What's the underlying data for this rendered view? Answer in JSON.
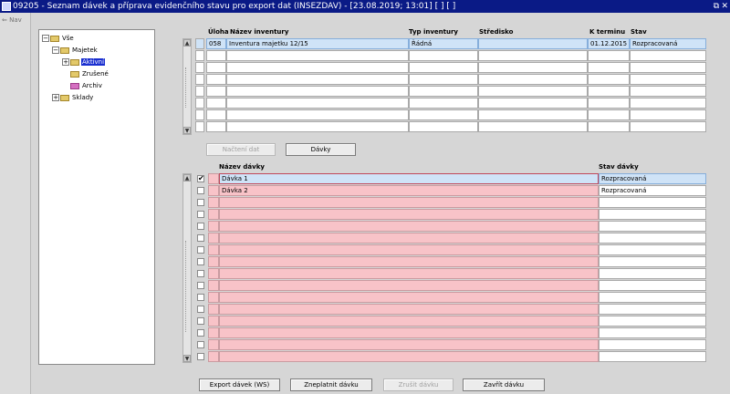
{
  "window": {
    "title": "09205 - Seznam dávek a příprava evidenčního stavu pro export dat (INSEZDAV) - [23.08.2019; 13:01]  [ ]  [ ]",
    "restore_glyph": "⧉",
    "close_glyph": "✕"
  },
  "nav": {
    "label": "Nav",
    "icon": "nav-arrow-icon"
  },
  "tree": {
    "nodes": [
      {
        "label": "Vše",
        "toggle": "−"
      },
      {
        "label": "Majetek",
        "toggle": "−"
      },
      {
        "label": "Aktivní",
        "toggle": "+",
        "selected": true
      },
      {
        "label": "Zrušené"
      },
      {
        "label": "Archiv"
      },
      {
        "label": "Sklady",
        "toggle": "+"
      }
    ]
  },
  "inventory": {
    "headers": {
      "uloha": "Úloha",
      "nazev": "Název inventury",
      "typ": "Typ inventury",
      "stredisko": "Středisko",
      "termin": "K terminu",
      "stav": "Stav"
    },
    "rows": [
      {
        "uloha": "058",
        "nazev": "Inventura majetku 12/15",
        "typ": "Řádná",
        "stredisko": "",
        "termin": "01.12.2015",
        "stav": "Rozpracovaná"
      }
    ]
  },
  "mid_buttons": {
    "nacteni": "Načtení dat",
    "davky": "Dávky"
  },
  "batches": {
    "headers": {
      "nazev": "Název dávky",
      "stav": "Stav dávky"
    },
    "rows": [
      {
        "checked": true,
        "nazev": "Dávka 1",
        "stav": "Rozpracovaná"
      },
      {
        "checked": false,
        "nazev": "Dávka 2",
        "stav": "Rozpracovaná"
      }
    ],
    "check_glyph": "✔"
  },
  "bottom_buttons": {
    "export": "Export dávek (WS)",
    "zneplatnit": "Zneplatnit dávku",
    "zrusit": "Zrušit dávku",
    "zavrit": "Zavřít dávku"
  },
  "colors": {
    "titlebar": "#0a1a86",
    "selected_row": "#cfe3f7",
    "pink_cell": "#f8c3c8",
    "tree_selected": "#1a2fd0"
  }
}
